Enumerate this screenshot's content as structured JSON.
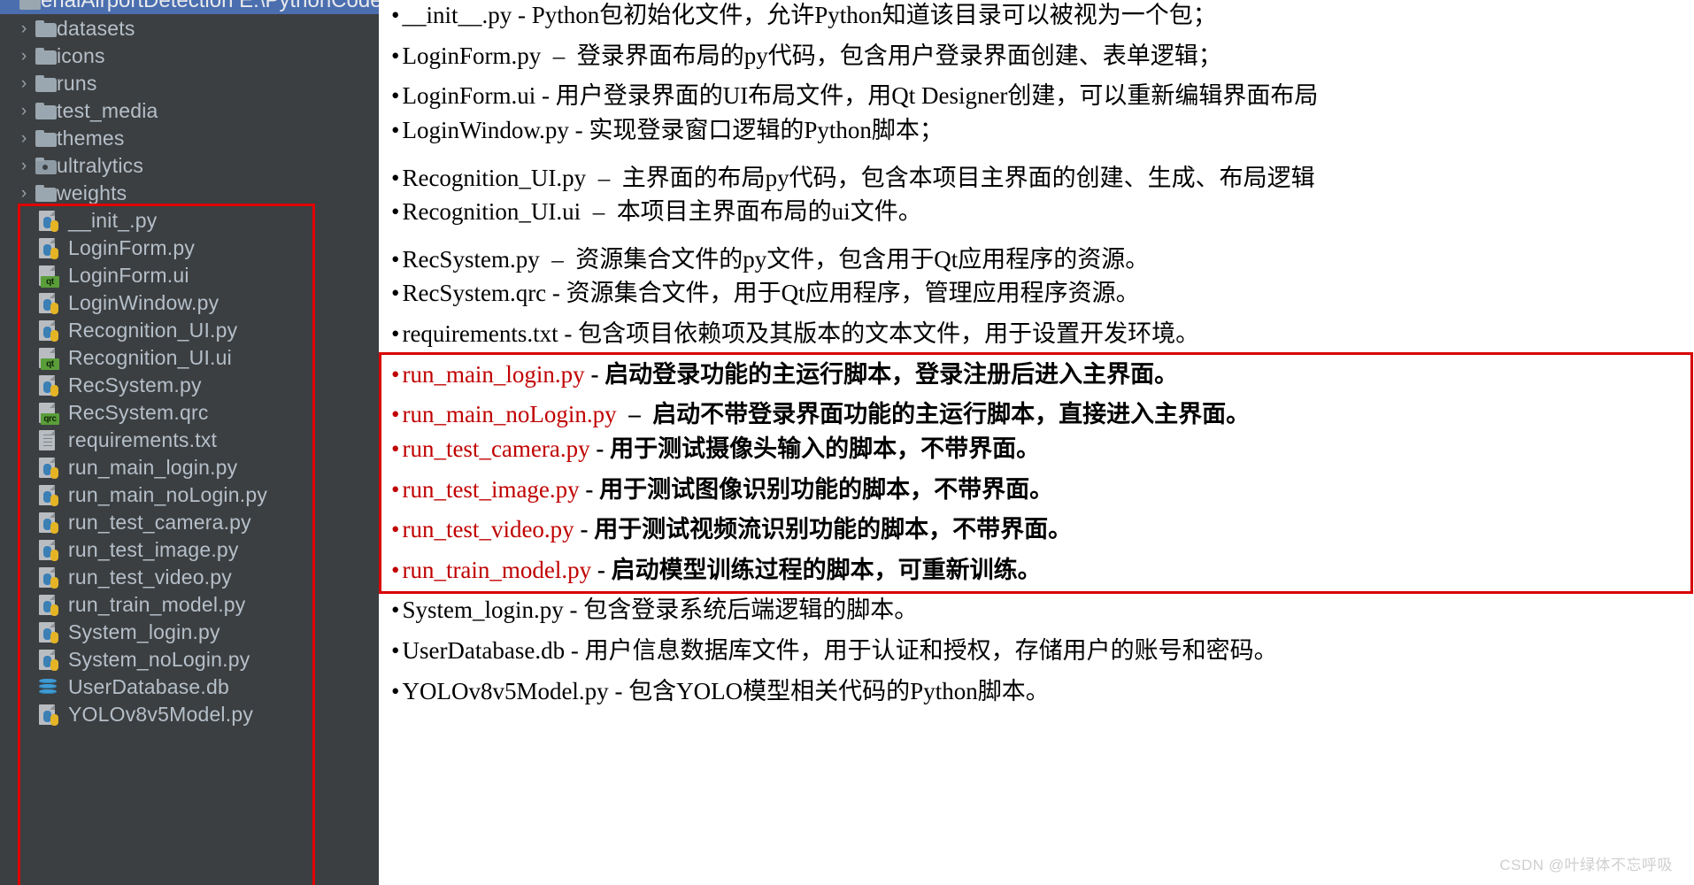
{
  "project_tree": {
    "root_label": "AerialAirportDetection E:\\PythonCode\\P\\",
    "folders": [
      {
        "label": "datasets",
        "icon": "folder-icon"
      },
      {
        "label": "icons",
        "icon": "folder-icon"
      },
      {
        "label": "runs",
        "icon": "folder-icon"
      },
      {
        "label": "test_media",
        "icon": "folder-icon"
      },
      {
        "label": "themes",
        "icon": "folder-icon"
      },
      {
        "label": "ultralytics",
        "icon": "python-package-folder-icon"
      },
      {
        "label": "weights",
        "icon": "folder-icon"
      }
    ],
    "files": [
      {
        "label": "__init_.py",
        "icon": "python-file-icon"
      },
      {
        "label": "LoginForm.py",
        "icon": "python-file-icon"
      },
      {
        "label": "LoginForm.ui",
        "icon": "qt-ui-file-icon",
        "tag": "qt"
      },
      {
        "label": "LoginWindow.py",
        "icon": "python-file-icon"
      },
      {
        "label": "Recognition_UI.py",
        "icon": "python-file-icon"
      },
      {
        "label": "Recognition_UI.ui",
        "icon": "qt-ui-file-icon",
        "tag": "qt"
      },
      {
        "label": "RecSystem.py",
        "icon": "python-file-icon"
      },
      {
        "label": "RecSystem.qrc",
        "icon": "qt-qrc-file-icon",
        "tag": "qrc"
      },
      {
        "label": "requirements.txt",
        "icon": "text-file-icon"
      },
      {
        "label": "run_main_login.py",
        "icon": "python-file-icon"
      },
      {
        "label": "run_main_noLogin.py",
        "icon": "python-file-icon"
      },
      {
        "label": "run_test_camera.py",
        "icon": "python-file-icon"
      },
      {
        "label": "run_test_image.py",
        "icon": "python-file-icon"
      },
      {
        "label": "run_test_video.py",
        "icon": "python-file-icon"
      },
      {
        "label": "run_train_model.py",
        "icon": "python-file-icon"
      },
      {
        "label": "System_login.py",
        "icon": "python-file-icon"
      },
      {
        "label": "System_noLogin.py",
        "icon": "python-file-icon"
      },
      {
        "label": "UserDatabase.db",
        "icon": "database-file-icon"
      },
      {
        "label": "YOLOv8v5Model.py",
        "icon": "python-file-icon"
      }
    ],
    "chevron_glyph": "›",
    "highlight_color": "#e00000"
  },
  "document": {
    "highlight_color": "#d80000",
    "entries": [
      {
        "bullet": "•",
        "name": "__init__.py",
        "sep": " - ",
        "desc": "Python包初始化文件，允许Python知道该目录可以被视为一个包；",
        "highlight": false,
        "gap": "none"
      },
      {
        "bullet": "•",
        "name": "LoginForm.py",
        "sep": "  –  ",
        "desc": "登录界面布局的py代码，包含用户登录界面创建、表单逻辑；",
        "highlight": false,
        "gap": "md"
      },
      {
        "bullet": "•",
        "name": "LoginForm.ui",
        "sep": " - ",
        "desc": "用户登录界面的UI布局文件，用Qt Designer创建，可以重新编辑界面布局",
        "highlight": false,
        "gap": "md"
      },
      {
        "bullet": "•",
        "name": "LoginWindow.py",
        "sep": " - ",
        "desc": "实现登录窗口逻辑的Python脚本；",
        "highlight": false,
        "gap": "sm"
      },
      {
        "bullet": "•",
        "name": "Recognition_UI.py",
        "sep": "  –  ",
        "desc": "主界面的布局py代码，包含本项目主界面的创建、生成、布局逻辑",
        "highlight": false,
        "gap": "lg"
      },
      {
        "bullet": "•",
        "name": "Recognition_UI.ui",
        "sep": "  –  ",
        "desc": "本项目主界面布局的ui文件。",
        "highlight": false,
        "gap": "sm"
      },
      {
        "bullet": "•",
        "name": "RecSystem.py",
        "sep": "  –  ",
        "desc": "资源集合文件的py文件，包含用于Qt应用程序的资源。",
        "highlight": false,
        "gap": "lg"
      },
      {
        "bullet": "•",
        "name": "RecSystem.qrc",
        "sep": " - ",
        "desc": "资源集合文件，用于Qt应用程序，管理应用程序资源。",
        "highlight": false,
        "gap": "sm"
      },
      {
        "bullet": "•",
        "name": "requirements.txt",
        "sep": " - ",
        "desc": "包含项目依赖项及其版本的文本文件，用于设置开发环境。",
        "highlight": false,
        "gap": "md"
      },
      {
        "bullet": "•",
        "name": "run_main_login.py",
        "sep": " - ",
        "desc": "启动登录功能的主运行脚本，登录注册后进入主界面。",
        "highlight": true,
        "gap": "md"
      },
      {
        "bullet": "•",
        "name": "run_main_noLogin.py",
        "sep": "  –  ",
        "desc": "启动不带登录界面功能的主运行脚本，直接进入主界面。",
        "highlight": true,
        "gap": "md"
      },
      {
        "bullet": "•",
        "name": "run_test_camera.py",
        "sep": " - ",
        "desc": "用于测试摄像头输入的脚本，不带界面。",
        "highlight": true,
        "gap": "sm"
      },
      {
        "bullet": "•",
        "name": "run_test_image.py",
        "sep": " - ",
        "desc": "用于测试图像识别功能的脚本，不带界面。",
        "highlight": true,
        "gap": "md"
      },
      {
        "bullet": "•",
        "name": "run_test_video.py",
        "sep": " - ",
        "desc": "用于测试视频流识别功能的脚本，不带界面。",
        "highlight": true,
        "gap": "md"
      },
      {
        "bullet": "•",
        "name": "run_train_model.py",
        "sep": " - ",
        "desc": "启动模型训练过程的脚本，可重新训练。",
        "highlight": true,
        "gap": "md"
      },
      {
        "bullet": "•",
        "name": "System_login.py",
        "sep": " - ",
        "desc": "包含登录系统后端逻辑的脚本。",
        "highlight": false,
        "gap": "md"
      },
      {
        "bullet": "•",
        "name": "UserDatabase.db",
        "sep": " - ",
        "desc": "用户信息数据库文件，用于认证和授权，存储用户的账号和密码。",
        "highlight": false,
        "gap": "md"
      },
      {
        "bullet": "•",
        "name": "YOLOv8v5Model.py",
        "sep": " - ",
        "desc": "包含YOLO模型相关代码的Python脚本。",
        "highlight": false,
        "gap": "md"
      }
    ]
  },
  "watermark": {
    "text": "CSDN @叶绿体不忘呼吸"
  }
}
